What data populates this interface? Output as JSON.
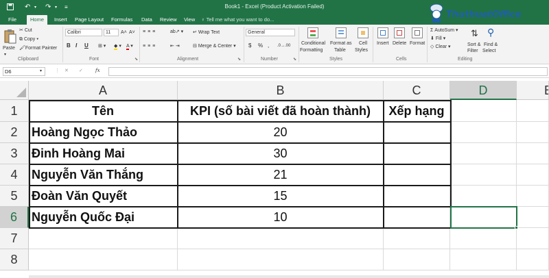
{
  "window": {
    "title": "Book1 - Excel (Product Activation Failed)"
  },
  "tabs": [
    "File",
    "Home",
    "Insert",
    "Page Layout",
    "Formulas",
    "Data",
    "Review",
    "View"
  ],
  "active_tab": "Home",
  "tell_me": "Tell me what you want to do...",
  "watermark": "ThuthuatOffice",
  "ribbon": {
    "clipboard": {
      "paste": "Paste",
      "cut": "Cut",
      "copy": "Copy",
      "format_painter": "Format Painter",
      "label": "Clipboard"
    },
    "font": {
      "name": "Calibri",
      "size": "11",
      "bold": "B",
      "italic": "I",
      "underline": "U",
      "label": "Font"
    },
    "alignment": {
      "wrap_text": "Wrap Text",
      "merge_center": "Merge & Center",
      "label": "Alignment"
    },
    "number": {
      "format": "General",
      "currency": "$",
      "percent": "%",
      "comma": ",",
      "label": "Number"
    },
    "styles": {
      "conditional_1": "Conditional",
      "conditional_2": "Formatting",
      "format_as_1": "Format as",
      "format_as_2": "Table",
      "cell_1": "Cell",
      "cell_2": "Styles",
      "label": "Styles"
    },
    "cells": {
      "insert": "Insert",
      "delete": "Delete",
      "format": "Format",
      "label": "Cells"
    },
    "editing": {
      "autosum": "AutoSum",
      "fill": "Fill",
      "clear": "Clear",
      "sort_1": "Sort &",
      "sort_2": "Filter",
      "find_1": "Find &",
      "find_2": "Select",
      "label": "Editing"
    }
  },
  "formula_bar": {
    "name_box": "D6",
    "fx": "fx",
    "value": ""
  },
  "sheet": {
    "columns": [
      "A",
      "B",
      "C",
      "D",
      "E"
    ],
    "rows": [
      "1",
      "2",
      "3",
      "4",
      "5",
      "6",
      "7",
      "8"
    ],
    "selected_cell": "D6",
    "cells": {
      "A1": "Tên",
      "B1": "KPI (số bài viết đã hoàn thành)",
      "C1": "Xếp hạng",
      "A2": "Hoàng Ngọc Thảo",
      "B2": "20",
      "A3": "Đinh Hoàng Mai",
      "B3": "30",
      "A4": "Nguyễn Văn Thắng",
      "B4": "21",
      "A5": "Đoàn Văn Quyết",
      "B5": "15",
      "A6": "Nguyễn Quốc Đại",
      "B6": "10"
    }
  },
  "colors": {
    "accent": "#217346",
    "grid_line": "#dadada",
    "header_bg": "#f3f3f3"
  }
}
